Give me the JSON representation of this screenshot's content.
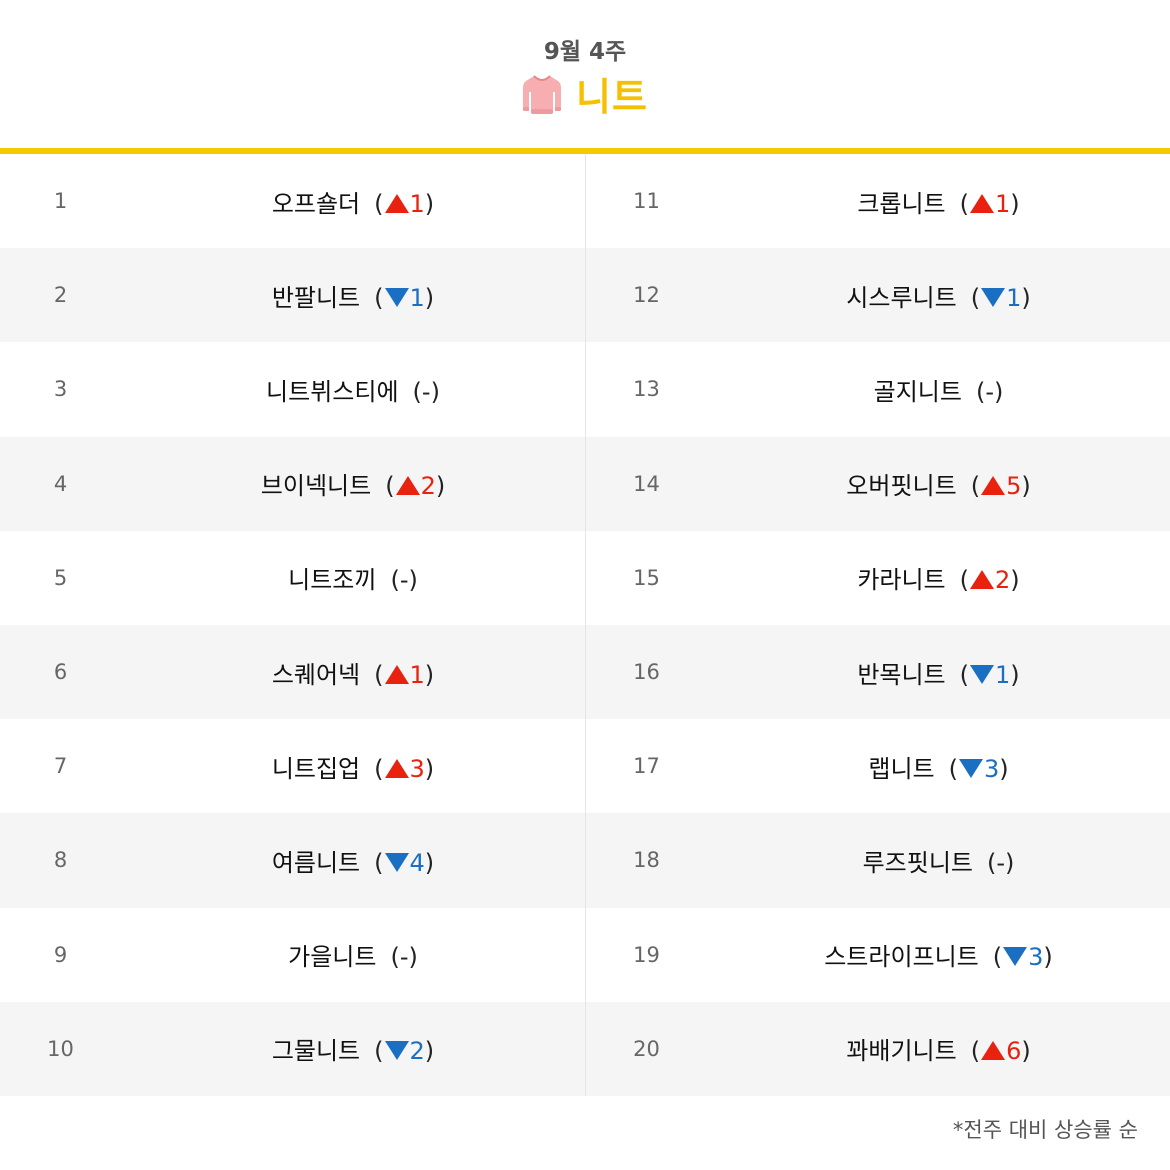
{
  "header": {
    "week": "9월 4주",
    "category": "니트",
    "icon": "sweater-icon"
  },
  "colors": {
    "accent": "#f5c800",
    "up": "#e8220f",
    "down": "#1a6fc2",
    "row_alt": "#f5f5f5"
  },
  "rankings_left": [
    {
      "rank": "1",
      "name": "오프숄더",
      "open": "(",
      "dir": "up",
      "value": "1",
      "close": ")"
    },
    {
      "rank": "2",
      "name": "반팔니트",
      "open": "(",
      "dir": "down",
      "value": "1",
      "close": ")"
    },
    {
      "rank": "3",
      "name": "니트뷔스티에",
      "open": "(",
      "dir": "same",
      "value": "-",
      "close": ")"
    },
    {
      "rank": "4",
      "name": "브이넥니트",
      "open": "(",
      "dir": "up",
      "value": "2",
      "close": ")"
    },
    {
      "rank": "5",
      "name": "니트조끼",
      "open": "(",
      "dir": "same",
      "value": "-",
      "close": ")"
    },
    {
      "rank": "6",
      "name": "스퀘어넥",
      "open": "(",
      "dir": "up",
      "value": "1",
      "close": ")"
    },
    {
      "rank": "7",
      "name": "니트집업",
      "open": "(",
      "dir": "up",
      "value": "3",
      "close": ")"
    },
    {
      "rank": "8",
      "name": "여름니트",
      "open": "(",
      "dir": "down",
      "value": "4",
      "close": ")"
    },
    {
      "rank": "9",
      "name": "가을니트",
      "open": "(",
      "dir": "same",
      "value": "-",
      "close": ")"
    },
    {
      "rank": "10",
      "name": "그물니트",
      "open": "(",
      "dir": "down",
      "value": "2",
      "close": ")"
    }
  ],
  "rankings_right": [
    {
      "rank": "11",
      "name": "크롭니트",
      "open": "(",
      "dir": "up",
      "value": "1",
      "close": ")"
    },
    {
      "rank": "12",
      "name": "시스루니트",
      "open": "(",
      "dir": "down",
      "value": "1",
      "close": ")"
    },
    {
      "rank": "13",
      "name": "골지니트",
      "open": "(",
      "dir": "same",
      "value": "-",
      "close": ")"
    },
    {
      "rank": "14",
      "name": "오버핏니트",
      "open": "(",
      "dir": "up",
      "value": "5",
      "close": ")"
    },
    {
      "rank": "15",
      "name": "카라니트",
      "open": "(",
      "dir": "up",
      "value": "2",
      "close": ")"
    },
    {
      "rank": "16",
      "name": "반목니트",
      "open": "(",
      "dir": "down",
      "value": "1",
      "close": ")"
    },
    {
      "rank": "17",
      "name": "랩니트",
      "open": "(",
      "dir": "down",
      "value": "3",
      "close": ")"
    },
    {
      "rank": "18",
      "name": "루즈핏니트",
      "open": "(",
      "dir": "same",
      "value": "-",
      "close": ")"
    },
    {
      "rank": "19",
      "name": "스트라이프니트",
      "open": "(",
      "dir": "down",
      "value": "3",
      "close": ")"
    },
    {
      "rank": "20",
      "name": "꽈배기니트",
      "open": "(",
      "dir": "up",
      "value": "6",
      "close": ")"
    }
  ],
  "footnote": "*전주 대비 상승률 순"
}
